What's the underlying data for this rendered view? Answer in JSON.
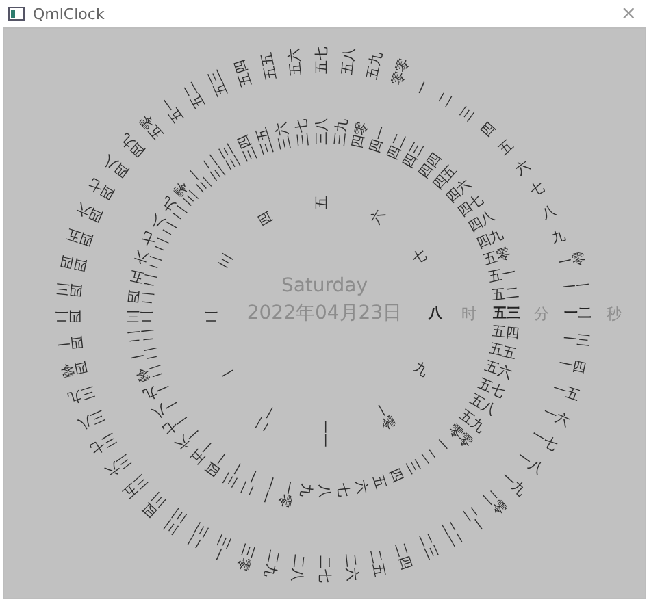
{
  "window": {
    "title": "QmlClock",
    "close": "×"
  },
  "day": "Saturday",
  "date": "2022年04月23日",
  "rings": [
    {
      "kind": "hour",
      "unit": "时",
      "items": [
        {
          "label": "一",
          "selected": false
        },
        {
          "label": "二",
          "selected": false
        },
        {
          "label": "三",
          "selected": false
        },
        {
          "label": "四",
          "selected": false
        },
        {
          "label": "五",
          "selected": false
        },
        {
          "label": "六",
          "selected": false
        },
        {
          "label": "七",
          "selected": false
        },
        {
          "label": "八",
          "selected": true
        },
        {
          "label": "九",
          "selected": false
        },
        {
          "label": "一零",
          "selected": false
        },
        {
          "label": "一一",
          "selected": false
        },
        {
          "label": "一二",
          "selected": false
        }
      ]
    },
    {
      "kind": "minute",
      "unit": "分",
      "items": [
        {
          "label": "零零",
          "selected": false
        },
        {
          "label": "一",
          "selected": false
        },
        {
          "label": "二",
          "selected": false
        },
        {
          "label": "三",
          "selected": false
        },
        {
          "label": "四",
          "selected": false
        },
        {
          "label": "五",
          "selected": false
        },
        {
          "label": "六",
          "selected": false
        },
        {
          "label": "七",
          "selected": false
        },
        {
          "label": "八",
          "selected": false
        },
        {
          "label": "九",
          "selected": false
        },
        {
          "label": "一零",
          "selected": false
        },
        {
          "label": "一一",
          "selected": false
        },
        {
          "label": "一二",
          "selected": false
        },
        {
          "label": "一三",
          "selected": false
        },
        {
          "label": "一四",
          "selected": false
        },
        {
          "label": "一五",
          "selected": false
        },
        {
          "label": "一六",
          "selected": false
        },
        {
          "label": "一七",
          "selected": false
        },
        {
          "label": "一八",
          "selected": false
        },
        {
          "label": "一九",
          "selected": false
        },
        {
          "label": "二零",
          "selected": false
        },
        {
          "label": "二一",
          "selected": false
        },
        {
          "label": "二二",
          "selected": false
        },
        {
          "label": "二三",
          "selected": false
        },
        {
          "label": "二四",
          "selected": false
        },
        {
          "label": "二五",
          "selected": false
        },
        {
          "label": "二六",
          "selected": false
        },
        {
          "label": "二七",
          "selected": false
        },
        {
          "label": "二八",
          "selected": false
        },
        {
          "label": "二九",
          "selected": false
        },
        {
          "label": "三零",
          "selected": false
        },
        {
          "label": "三一",
          "selected": false
        },
        {
          "label": "三二",
          "selected": false
        },
        {
          "label": "三三",
          "selected": false
        },
        {
          "label": "三四",
          "selected": false
        },
        {
          "label": "三五",
          "selected": false
        },
        {
          "label": "三六",
          "selected": false
        },
        {
          "label": "三七",
          "selected": false
        },
        {
          "label": "三八",
          "selected": false
        },
        {
          "label": "三九",
          "selected": false
        },
        {
          "label": "四零",
          "selected": false
        },
        {
          "label": "四一",
          "selected": false
        },
        {
          "label": "四二",
          "selected": false
        },
        {
          "label": "四三",
          "selected": false
        },
        {
          "label": "四四",
          "selected": false
        },
        {
          "label": "四五",
          "selected": false
        },
        {
          "label": "四六",
          "selected": false
        },
        {
          "label": "四七",
          "selected": false
        },
        {
          "label": "四八",
          "selected": false
        },
        {
          "label": "四九",
          "selected": false
        },
        {
          "label": "五零",
          "selected": false
        },
        {
          "label": "五一",
          "selected": false
        },
        {
          "label": "五二",
          "selected": false
        },
        {
          "label": "五三",
          "selected": true
        },
        {
          "label": "五四",
          "selected": false
        },
        {
          "label": "五五",
          "selected": false
        },
        {
          "label": "五六",
          "selected": false
        },
        {
          "label": "五七",
          "selected": false
        },
        {
          "label": "五八",
          "selected": false
        },
        {
          "label": "五九",
          "selected": false
        }
      ]
    },
    {
      "kind": "second",
      "unit": "秒",
      "items": [
        {
          "label": "零零",
          "selected": false
        },
        {
          "label": "一",
          "selected": false
        },
        {
          "label": "二",
          "selected": false
        },
        {
          "label": "三",
          "selected": false
        },
        {
          "label": "四",
          "selected": false
        },
        {
          "label": "五",
          "selected": false
        },
        {
          "label": "六",
          "selected": false
        },
        {
          "label": "七",
          "selected": false
        },
        {
          "label": "八",
          "selected": false
        },
        {
          "label": "九",
          "selected": false
        },
        {
          "label": "一零",
          "selected": false
        },
        {
          "label": "一一",
          "selected": false
        },
        {
          "label": "一二",
          "selected": true
        },
        {
          "label": "一三",
          "selected": false
        },
        {
          "label": "一四",
          "selected": false
        },
        {
          "label": "一五",
          "selected": false
        },
        {
          "label": "一六",
          "selected": false
        },
        {
          "label": "一七",
          "selected": false
        },
        {
          "label": "一八",
          "selected": false
        },
        {
          "label": "一九",
          "selected": false
        },
        {
          "label": "二零",
          "selected": false
        },
        {
          "label": "二一",
          "selected": false
        },
        {
          "label": "二二",
          "selected": false
        },
        {
          "label": "二三",
          "selected": false
        },
        {
          "label": "二四",
          "selected": false
        },
        {
          "label": "二五",
          "selected": false
        },
        {
          "label": "二六",
          "selected": false
        },
        {
          "label": "二七",
          "selected": false
        },
        {
          "label": "二八",
          "selected": false
        },
        {
          "label": "二九",
          "selected": false
        },
        {
          "label": "三零",
          "selected": false
        },
        {
          "label": "三一",
          "selected": false
        },
        {
          "label": "三二",
          "selected": false
        },
        {
          "label": "三三",
          "selected": false
        },
        {
          "label": "三四",
          "selected": false
        },
        {
          "label": "三五",
          "selected": false
        },
        {
          "label": "三六",
          "selected": false
        },
        {
          "label": "三七",
          "selected": false
        },
        {
          "label": "三八",
          "selected": false
        },
        {
          "label": "三九",
          "selected": false
        },
        {
          "label": "四零",
          "selected": false
        },
        {
          "label": "四一",
          "selected": false
        },
        {
          "label": "四二",
          "selected": false
        },
        {
          "label": "四三",
          "selected": false
        },
        {
          "label": "四四",
          "selected": false
        },
        {
          "label": "四五",
          "selected": false
        },
        {
          "label": "四六",
          "selected": false
        },
        {
          "label": "四七",
          "selected": false
        },
        {
          "label": "四八",
          "selected": false
        },
        {
          "label": "四九",
          "selected": false
        },
        {
          "label": "五零",
          "selected": false
        },
        {
          "label": "五一",
          "selected": false
        },
        {
          "label": "五二",
          "selected": false
        },
        {
          "label": "五三",
          "selected": false
        },
        {
          "label": "五四",
          "selected": false
        },
        {
          "label": "五五",
          "selected": false
        },
        {
          "label": "五六",
          "selected": false
        },
        {
          "label": "五七",
          "selected": false
        },
        {
          "label": "五八",
          "selected": false
        },
        {
          "label": "五九",
          "selected": false
        }
      ]
    }
  ]
}
